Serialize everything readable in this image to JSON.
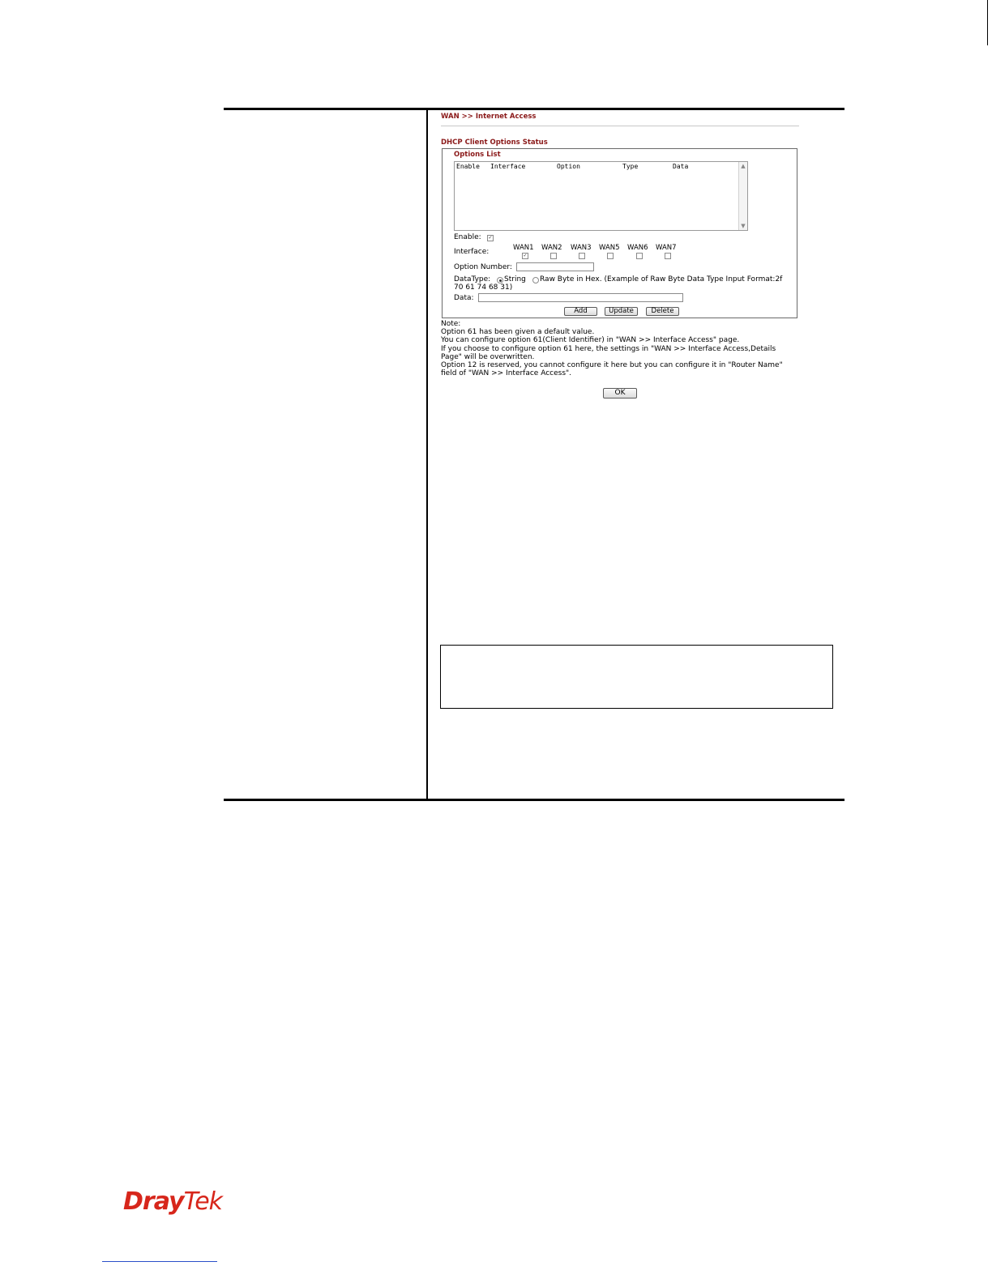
{
  "breadcrumb": "WAN >> Internet Access",
  "section_title": "DHCP Client Options Status",
  "options_list": {
    "legend": "Options List",
    "columns": [
      "Enable",
      "Interface",
      "Option",
      "Type",
      "Data"
    ]
  },
  "form": {
    "enable_label": "Enable:",
    "enable_checked": true,
    "interface_label": "Interface:",
    "interfaces": [
      {
        "name": "WAN1",
        "checked": true
      },
      {
        "name": "WAN2",
        "checked": false
      },
      {
        "name": "WAN3",
        "checked": false
      },
      {
        "name": "WAN5",
        "checked": false
      },
      {
        "name": "WAN6",
        "checked": false
      },
      {
        "name": "WAN7",
        "checked": false
      }
    ],
    "option_number_label": "Option Number:",
    "option_number_value": "",
    "datatype_label": "DataType:",
    "datatype_string": "String",
    "datatype_raw": "Raw Byte in Hex. (Example of Raw Byte Data Type Input Format:2f",
    "datatype_raw_cont": "70 61 74 68 31)",
    "datatype_selected": "String",
    "data_label": "Data:",
    "data_value": ""
  },
  "buttons": {
    "add": "Add",
    "update": "Update",
    "delete": "Delete",
    "ok": "OK"
  },
  "note": [
    "Note:",
    "Option 61 has been given a default value.",
    "You can configure option 61(Client Identifier) in \"WAN >> Interface Access\" page.",
    "If you choose to configure option 61 here, the settings in \"WAN >> Interface Access,Details",
    "Page\" will be overwritten.",
    "Option 12 is reserved, you cannot configure it here but you can configure it in \"Router Name\"",
    "field of \"WAN >> Interface Access\"."
  ],
  "logo": {
    "part1": "Dray",
    "part2": "Tek"
  },
  "colors": {
    "accent": "#8b1a1a",
    "logo": "#d7261b",
    "link": "#2b4fc9"
  }
}
